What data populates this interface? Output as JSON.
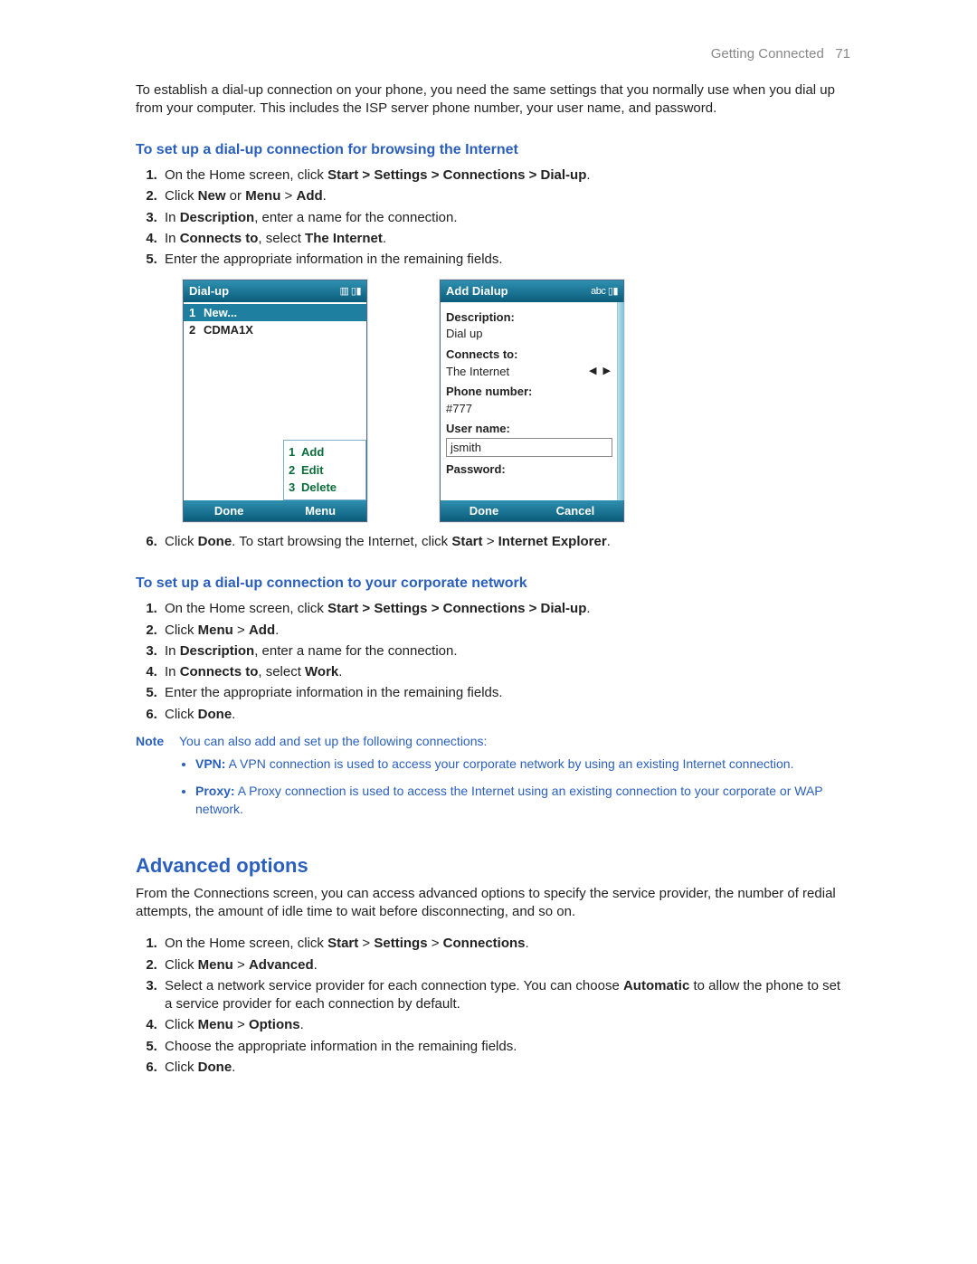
{
  "header": {
    "section": "Getting Connected",
    "page_number": "71"
  },
  "intro": "To establish a dial-up connection on your phone, you need the same settings that you normally use when you dial up from your computer. This includes the ISP server phone number, your user name, and password.",
  "proc1": {
    "title": "To set up a dial-up connection for browsing the Internet",
    "steps": [
      {
        "pre": "On the Home screen, click ",
        "bold": "Start > Settings > Connections > Dial-up",
        "post": "."
      },
      {
        "pre": "Click ",
        "bold": "New",
        "mid": " or ",
        "bold2": "Menu",
        "sep": " > ",
        "bold3": "Add",
        "post": "."
      },
      {
        "pre": "In ",
        "bold": "Description",
        "post": ", enter a name for the connection."
      },
      {
        "pre": "In ",
        "bold": "Connects to",
        "mid": ", select ",
        "bold2": "The Internet",
        "post": "."
      },
      {
        "pre": "Enter the appropriate information in the remaining fields.",
        "bold": "",
        "post": ""
      }
    ],
    "step6": {
      "pre": "Click ",
      "bold": "Done",
      "mid": ". To start browsing the Internet, click ",
      "bold2": "Start",
      "sep": " > ",
      "bold3": "Internet Explorer",
      "post": "."
    }
  },
  "phone_left": {
    "title": "Dial-up",
    "indicator": "▥ ▯▮",
    "rows": [
      {
        "num": "1",
        "label": "New...",
        "selected": true
      },
      {
        "num": "2",
        "label": "CDMA1X",
        "selected": false
      }
    ],
    "menu": [
      {
        "num": "1",
        "label": "Add"
      },
      {
        "num": "2",
        "label": "Edit"
      },
      {
        "num": "3",
        "label": "Delete"
      }
    ],
    "soft_left": "Done",
    "soft_right": "Menu"
  },
  "phone_right": {
    "title": "Add Dialup",
    "indicator": "abc ▯▮",
    "labels": {
      "description": "Description:",
      "connects_to": "Connects to:",
      "phone_number": "Phone number:",
      "user_name": "User name:",
      "password": "Password:"
    },
    "values": {
      "description": "Dial up",
      "connects_to": "The Internet",
      "phone_number": "#777",
      "user_name": "jsmith"
    },
    "soft_left": "Done",
    "soft_right": "Cancel"
  },
  "proc2": {
    "title": "To set up a dial-up connection to your corporate network",
    "steps": [
      {
        "pre": "On the Home screen, click ",
        "bold": "Start > Settings > Connections > Dial-up",
        "post": "."
      },
      {
        "pre": "Click ",
        "bold": "Menu",
        "sep": " > ",
        "bold2": "Add",
        "post": "."
      },
      {
        "pre": "In ",
        "bold": "Description",
        "post": ", enter a name for the connection."
      },
      {
        "pre": "In ",
        "bold": "Connects to",
        "mid": ", select ",
        "bold2": "Work",
        "post": "."
      },
      {
        "pre": "Enter the appropriate information in the remaining fields.",
        "bold": "",
        "post": ""
      },
      {
        "pre": "Click ",
        "bold": "Done",
        "post": "."
      }
    ]
  },
  "note": {
    "label": "Note",
    "intro": "You can also add and set up the following connections:",
    "items": [
      {
        "bold": "VPN:",
        "text": " A VPN connection is used to access your corporate network by using an existing Internet connection."
      },
      {
        "bold": "Proxy:",
        "text": " A Proxy connection is used to access the Internet using an existing connection to your corporate or WAP network."
      }
    ]
  },
  "advanced": {
    "title": "Advanced options",
    "intro": "From the Connections screen, you can access advanced options to specify the service provider, the number of redial attempts, the amount of idle time to wait before disconnecting, and so on.",
    "steps": [
      {
        "pre": "On the Home screen, click ",
        "bold": "Start",
        "sep": " > ",
        "bold2": "Settings",
        "sep2": " > ",
        "bold3": "Connections",
        "post": "."
      },
      {
        "pre": "Click ",
        "bold": "Menu",
        "sep": " > ",
        "bold2": "Advanced",
        "post": "."
      },
      {
        "pre": "Select a network service provider for each connection type. You can choose ",
        "bold": "Automatic",
        "post": " to allow the phone to set a service provider for each connection by default."
      },
      {
        "pre": "Click ",
        "bold": "Menu",
        "sep": " > ",
        "bold2": "Options",
        "post": "."
      },
      {
        "pre": "Choose the appropriate information in the remaining fields.",
        "bold": "",
        "post": ""
      },
      {
        "pre": "Click ",
        "bold": "Done",
        "post": "."
      }
    ]
  }
}
